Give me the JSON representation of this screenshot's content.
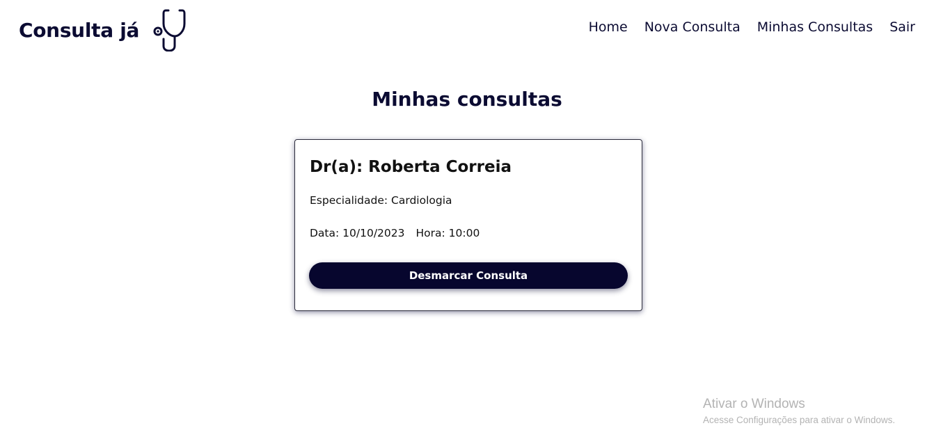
{
  "header": {
    "logo_text": "Consulta já",
    "logo_icon": "stethoscope-icon",
    "nav": [
      {
        "label": "Home"
      },
      {
        "label": "Nova Consulta"
      },
      {
        "label": "Minhas Consultas"
      },
      {
        "label": "Sair"
      }
    ]
  },
  "main": {
    "title": "Minhas consultas",
    "appointment": {
      "doctor": "Dr(a): Roberta Correia",
      "specialty": "Especialidade: Cardiologia",
      "date": "Data: 10/10/2023",
      "time": "Hora: 10:00",
      "cancel_label": "Desmarcar Consulta"
    }
  },
  "watermark": {
    "title": "Ativar o Windows",
    "subtitle": "Acesse Configurações para ativar o Windows."
  },
  "colors": {
    "brand_dark": "#07062e",
    "text": "#0b0b32"
  }
}
